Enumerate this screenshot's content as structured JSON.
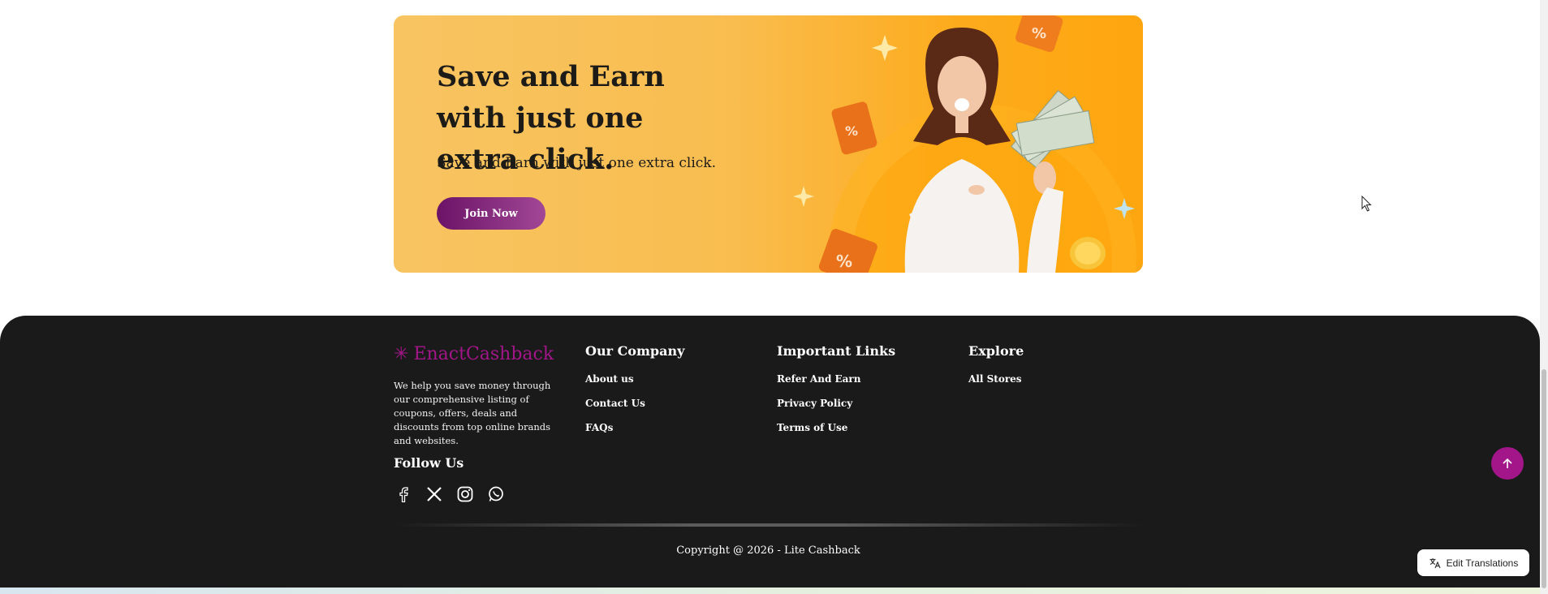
{
  "banner": {
    "title": "Save and Earn with just one extra click.",
    "subtitle": "Save and Earn with just one extra click.",
    "button_label": "Join Now",
    "coupon_text": "%"
  },
  "footer": {
    "brand_name": "EnactCashback",
    "description": "We help you save money through our comprehensive listing of coupons, offers, deals and discounts from top online brands and websites.",
    "follow_title": "Follow Us",
    "socials": [
      "facebook-icon",
      "x-icon",
      "instagram-icon",
      "whatsapp-icon"
    ],
    "columns": [
      {
        "title": "Our Company",
        "links": [
          "About us",
          "Contact Us",
          "FAQs"
        ]
      },
      {
        "title": "Important Links",
        "links": [
          "Refer And Earn",
          "Privacy Policy",
          "Terms of Use"
        ]
      },
      {
        "title": "Explore",
        "links": [
          "All Stores"
        ]
      }
    ],
    "copyright": "Copyright @ 2026 - Lite Cashback"
  },
  "widgets": {
    "edit_translations": "Edit Translations"
  },
  "colors": {
    "brand": "#a2168a",
    "banner_start": "#f8c462",
    "banner_end": "#fea60f",
    "footer_bg": "#1b1a1a",
    "button_start": "#6b1367",
    "button_end": "#a24796"
  }
}
